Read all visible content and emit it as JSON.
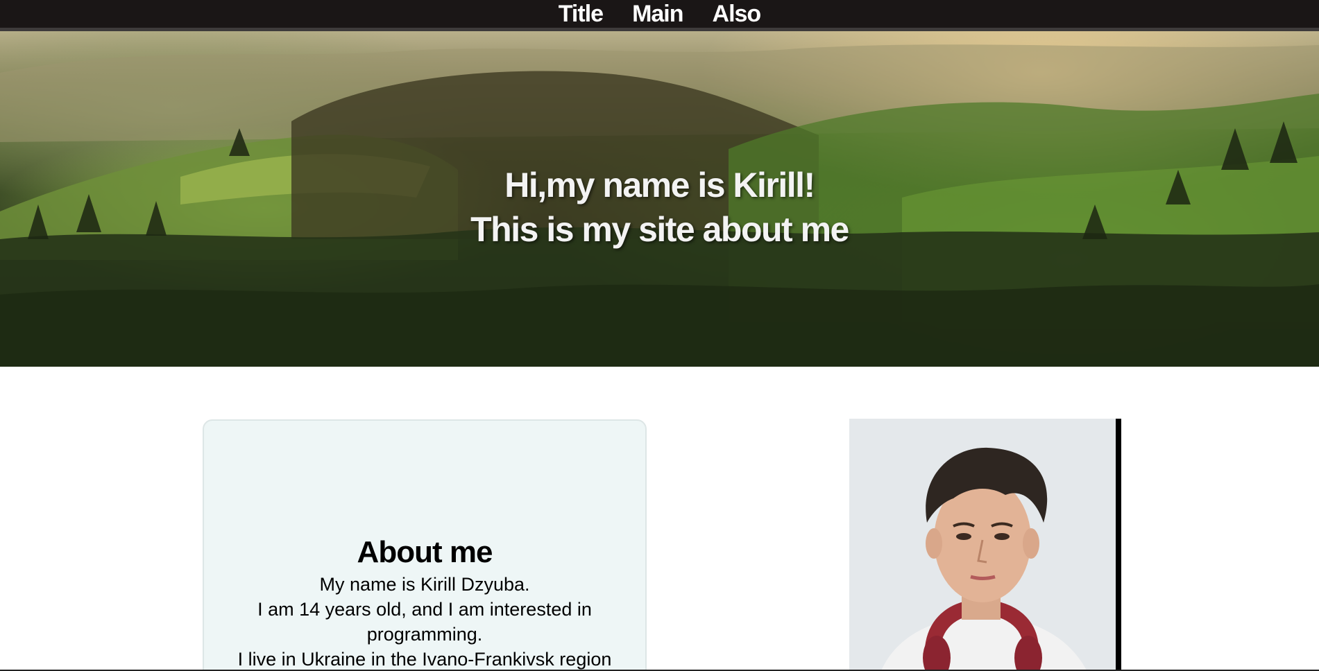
{
  "nav": {
    "items": [
      {
        "label": "Title"
      },
      {
        "label": "Main"
      },
      {
        "label": "Also"
      }
    ]
  },
  "hero": {
    "line1": "Hi,my name is Kirill!",
    "line2": "This is my site about me"
  },
  "about": {
    "title": "About me",
    "lines": [
      "My name is Kirill Dzyuba.",
      "I am 14 years old, and I am interested in",
      "programming.",
      "I live in Ukraine in the Ivano-Frankivsk region"
    ]
  },
  "colors": {
    "navbar": "#1a1616",
    "card_bg": "#eef6f6"
  }
}
